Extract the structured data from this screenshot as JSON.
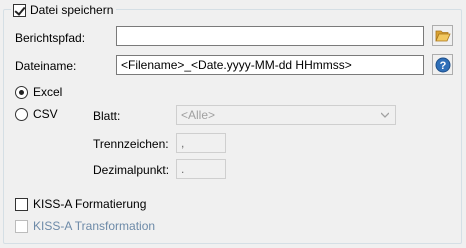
{
  "group": {
    "legend_label": "Datei speichern",
    "legend_checked": true
  },
  "berichtspfad": {
    "label": "Berichtspfad:",
    "value": "",
    "browse_icon": "folder-open-icon"
  },
  "dateiname": {
    "label": "Dateiname:",
    "value": "<Filename>_<Date.yyyy-MM-dd HHmmss>",
    "help_icon": "help-icon"
  },
  "format": {
    "excel_label": "Excel",
    "excel_selected": true,
    "csv_label": "CSV",
    "csv_selected": false
  },
  "csv_options": {
    "blatt_label": "Blatt:",
    "blatt_value": "<Alle>",
    "trennzeichen_label": "Trennzeichen:",
    "trennzeichen_value": ",",
    "dezimalpunkt_label": "Dezimalpunkt:",
    "dezimalpunkt_value": "."
  },
  "kiss_formatierung": {
    "label": "KISS-A Formatierung",
    "checked": false
  },
  "kiss_transformation": {
    "label": "KISS-A Transformation",
    "checked": false,
    "enabled": false
  },
  "colors": {
    "accent_help": "#2f6fb8",
    "folder": "#e8b84a",
    "disabled_text": "#6d8aa8"
  }
}
